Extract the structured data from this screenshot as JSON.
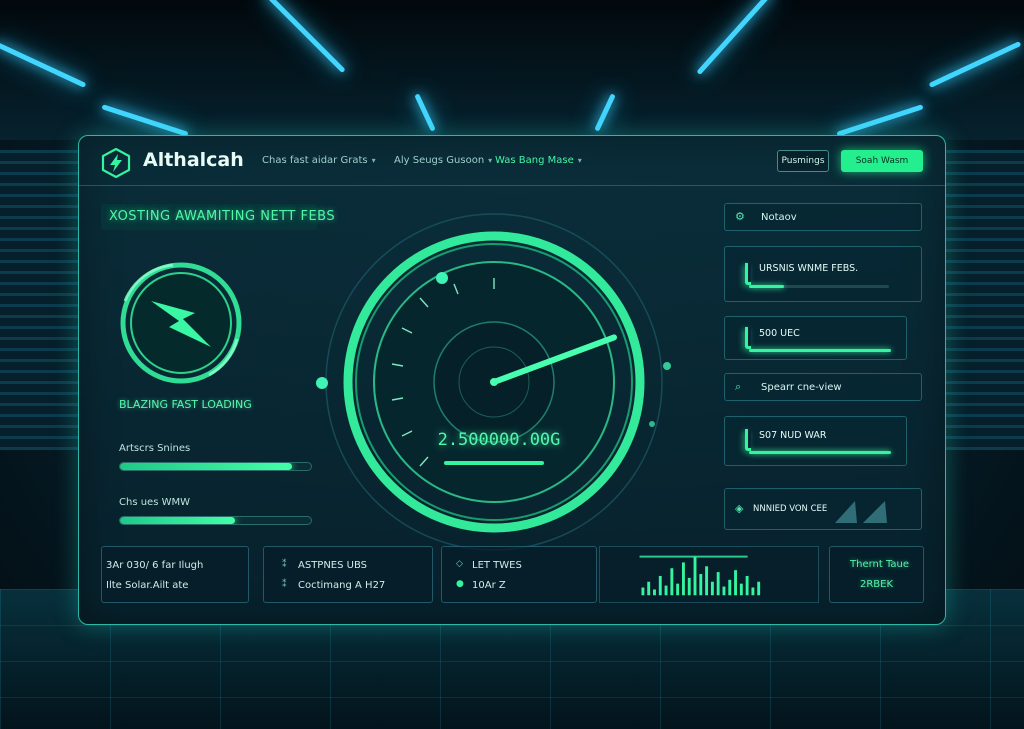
{
  "app": {
    "title": "Althalcah"
  },
  "nav": {
    "items": [
      {
        "label": "Chas fast aidar Grats",
        "active": false
      },
      {
        "label": "Aly Seugs Gusoon",
        "active": false
      },
      {
        "label": "Was Bang Mase",
        "active": true
      }
    ]
  },
  "header": {
    "secondary_button": "Pusmings",
    "primary_button": "Soah Wasm"
  },
  "left": {
    "headline": "XOSTING AWAMITING NETT FEBS",
    "feature_label": "BLAZING FAST LOADING",
    "stats": [
      {
        "label": "Artscrs Snines",
        "progress": 0.9
      },
      {
        "label": "Chs ues WMW",
        "progress": 0.6
      }
    ]
  },
  "gauge": {
    "readout": "2.500000.00G",
    "needle_level": 0.72
  },
  "right": {
    "panels": [
      {
        "icon": "gear-icon",
        "title": "Notaov"
      },
      {
        "value": "URSNIS WNME FEBS.",
        "progress": 0.25
      },
      {
        "value": "500 UEC"
      },
      {
        "icon": "search-icon",
        "title": "Spearr cne-view"
      },
      {
        "value": "S07 NUD WAR"
      },
      {
        "icon": "diamond-icon",
        "title": "NNNIED VON CEE"
      }
    ]
  },
  "bottom": {
    "card1": {
      "line1": "3Ar 030/ 6 far Ilugh",
      "line2": "Ilte Solar.Ailt ate"
    },
    "card2": {
      "line1": "ASTPNES UBS",
      "line2": "Coctimang A H27"
    },
    "card3": {
      "line1": "LET TWES",
      "line2": "10Ar Z"
    },
    "live": {
      "title": "Thernt Taue",
      "value": "2RBEK"
    }
  },
  "colors": {
    "accent": "#35f4a0",
    "panel_border": "#2fb6a8",
    "beam": "#42d6ff"
  }
}
